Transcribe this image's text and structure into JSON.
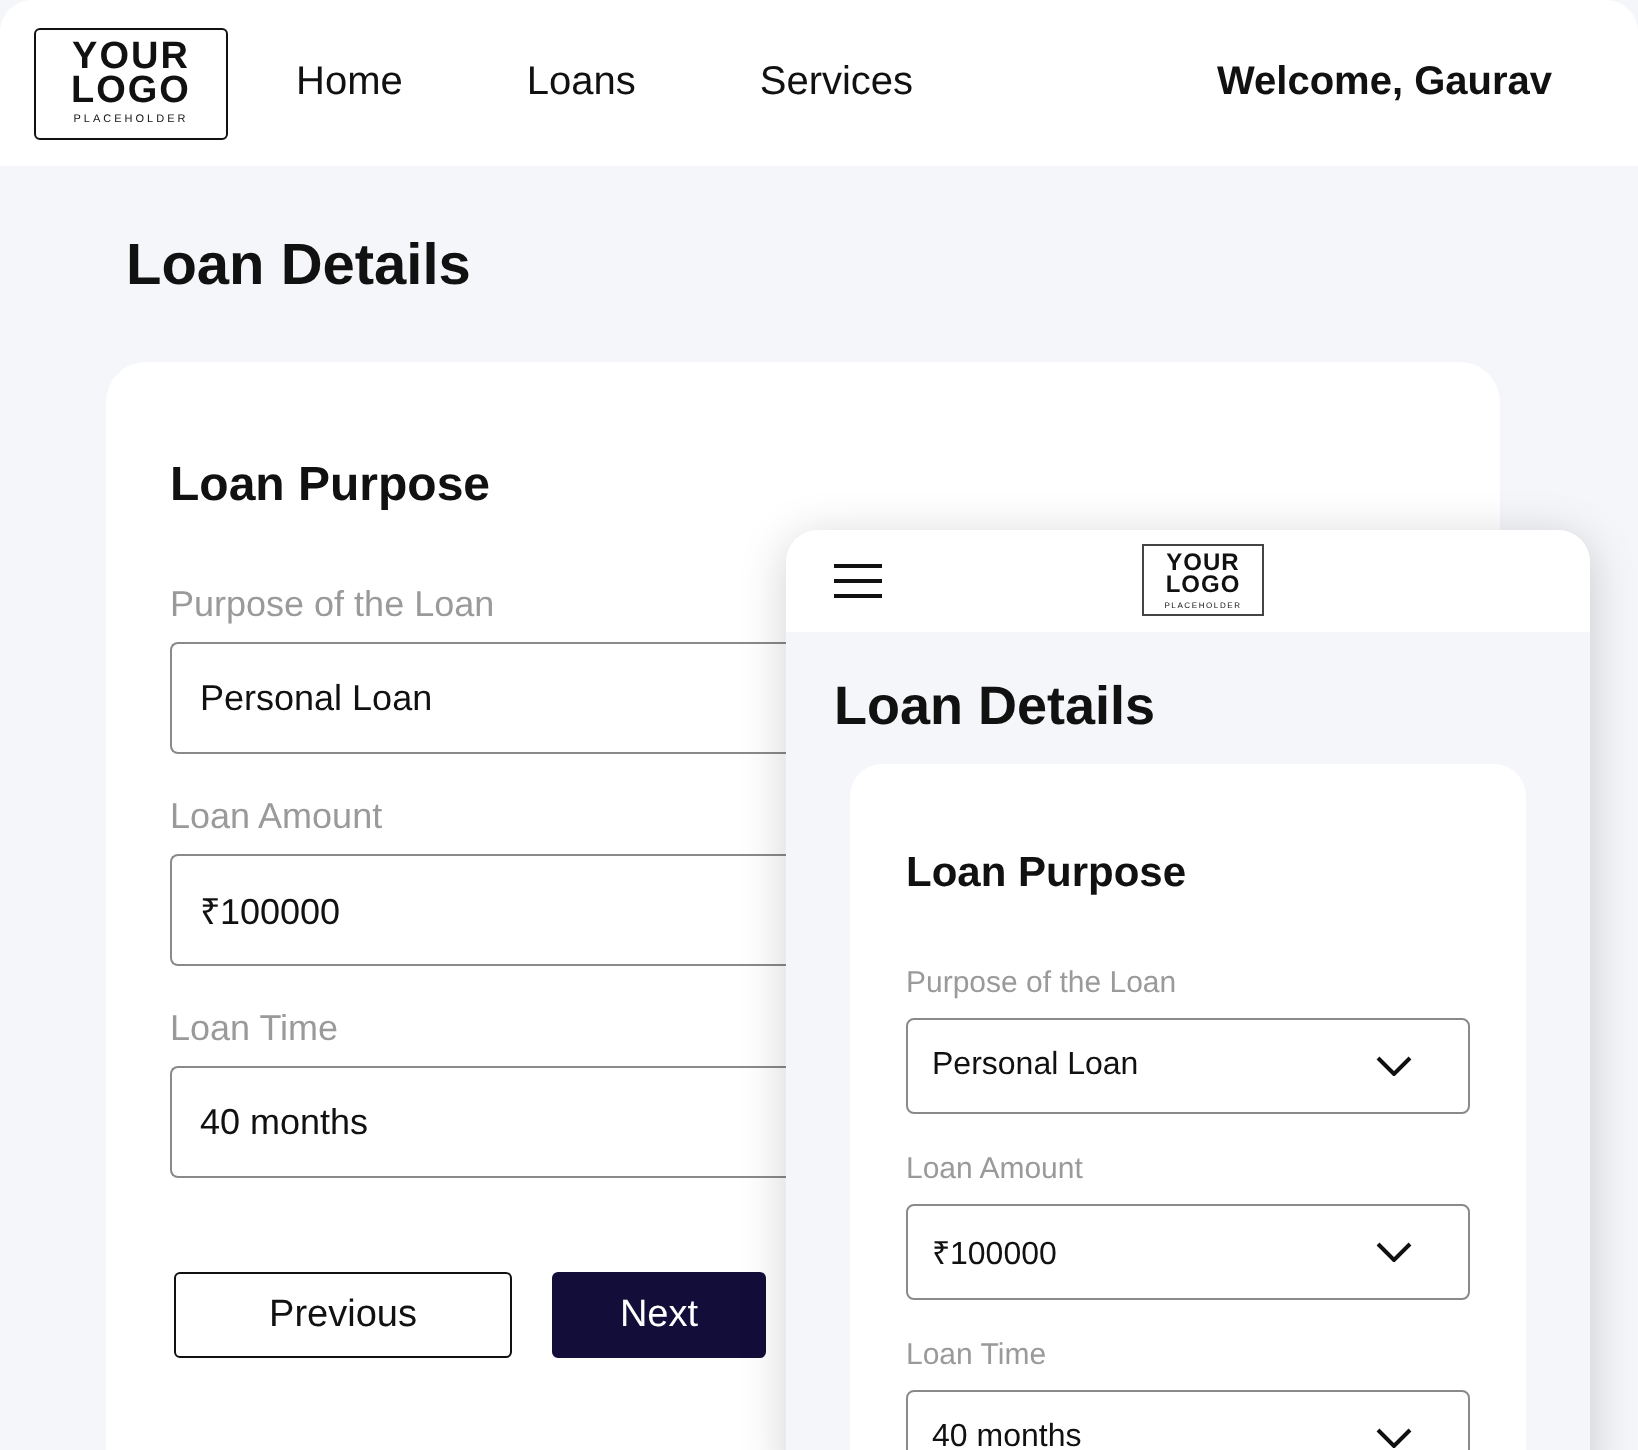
{
  "desktop": {
    "logo": {
      "lines": [
        "YOUR",
        "LOGO"
      ],
      "tagline": "PLACEHOLDER"
    },
    "nav": [
      {
        "label": "Home"
      },
      {
        "label": "Loans"
      },
      {
        "label": "Services"
      }
    ],
    "welcome": "Welcome, Gaurav",
    "title": "Loan Details",
    "card": {
      "heading": "Loan Purpose",
      "fields": [
        {
          "label": "Purpose of the Loan",
          "value": "Personal Loan"
        },
        {
          "label": "Loan Amount",
          "value": "₹100000"
        },
        {
          "label": "Loan Time",
          "value": "40 months"
        }
      ]
    },
    "buttons": [
      {
        "label": "Previous",
        "kind": "secondary"
      },
      {
        "label": "Next",
        "kind": "primary"
      }
    ]
  },
  "mobile": {
    "logo": {
      "lines": [
        "YOUR",
        "LOGO"
      ],
      "tagline": "PLACEHOLDER"
    },
    "title": "Loan Details",
    "card": {
      "heading": "Loan Purpose",
      "fields": [
        {
          "label": "Purpose of the Loan",
          "value": "Personal Loan"
        },
        {
          "label": "Loan Amount",
          "value": "₹100000"
        },
        {
          "label": "Loan Time",
          "value": "40 months"
        }
      ]
    }
  }
}
